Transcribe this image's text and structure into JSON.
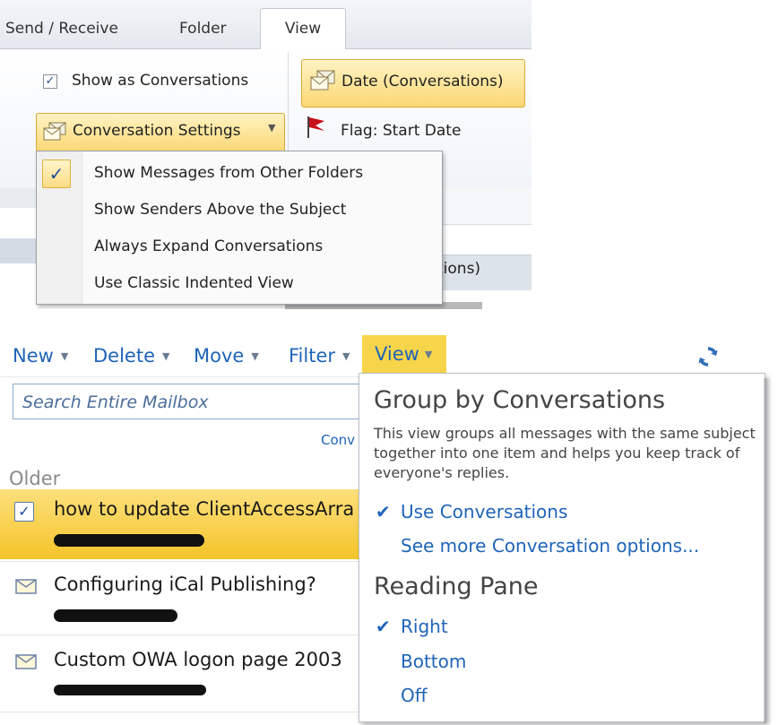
{
  "ribbon": {
    "tabs": [
      "Send / Receive",
      "Folder",
      "View"
    ],
    "active_tab": "View",
    "show_as_conversations": {
      "label": "Show as Conversations",
      "checked": true
    },
    "conversation_settings_label": "Conversation Settings",
    "date_conversations_label": "Date (Conversations)",
    "flag_start_date_label": "Flag: Start Date",
    "underlying_fragment": "tions)"
  },
  "conversation_menu": {
    "items": [
      {
        "label": "Show Messages from Other Folders",
        "checked": true
      },
      {
        "label": "Show Senders Above the Subject",
        "checked": false
      },
      {
        "label": "Always Expand Conversations",
        "checked": false
      },
      {
        "label": "Use Classic Indented View",
        "checked": false
      }
    ]
  },
  "owa": {
    "toolbar": [
      "New",
      "Delete",
      "Move",
      "Filter",
      "View"
    ],
    "search_placeholder": "Search Entire Mailbox",
    "conv_fragment": "Conv",
    "older_label": "Older",
    "messages": [
      {
        "subject": "how to update ClientAccessArra",
        "selected": true,
        "icon": "checkbox-icon"
      },
      {
        "subject": "Configuring iCal Publishing?",
        "selected": false,
        "icon": "envelope-icon"
      },
      {
        "subject": "Custom OWA logon page 2003",
        "selected": false,
        "icon": "envelope-icon"
      }
    ]
  },
  "view_panel": {
    "group_title": "Group by Conversations",
    "group_desc": "This view groups all messages with the same subject together into one item and helps you keep track of everyone's replies.",
    "use_conversations": "Use Conversations",
    "see_more": "See more Conversation options...",
    "reading_pane_title": "Reading Pane",
    "reading_pane_options": [
      "Right",
      "Bottom",
      "Off"
    ],
    "reading_pane_selected": "Right"
  },
  "colors": {
    "highlight": "#f7d54a",
    "link": "#1f64b8"
  }
}
